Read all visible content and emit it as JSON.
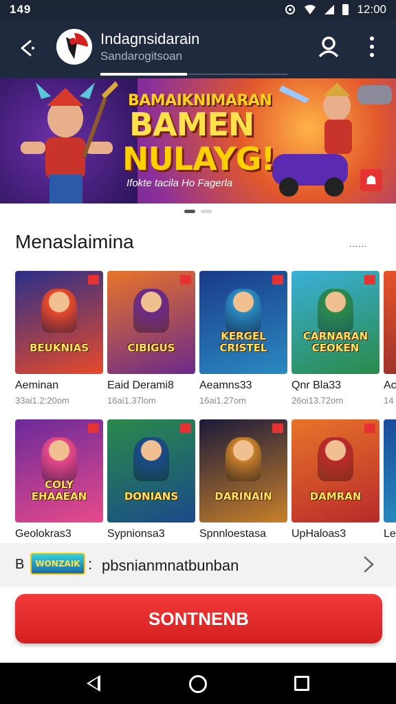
{
  "status_bar": {
    "left": "149",
    "time": "12:00"
  },
  "app_bar": {
    "title": "Indagnsidarain",
    "subtitle": "Sandarogitsoan",
    "icons": {
      "back": "back-arrow-icon",
      "account": "account-icon",
      "menu": "more-vert-icon"
    }
  },
  "banner": {
    "line1": "BAMAIKNIMARAN",
    "line2": "BAMEN",
    "line3": "NULAYG!",
    "tagline": "Ifokte tacila  Ho Fagerla",
    "slides": 2,
    "active_slide": 1
  },
  "section": {
    "title": "Menaslaimina",
    "more": "......"
  },
  "games_row1": [
    {
      "thumb_label": "BEUKNIAS",
      "title": "Aeminan",
      "sub": "33ai1.2:20om",
      "colors": [
        "#2a2f8a",
        "#e84a2a"
      ]
    },
    {
      "thumb_label": "CIBIGUS",
      "title": "Eaid Derami8",
      "sub": "16ai1.37lom",
      "colors": [
        "#e8742a",
        "#6a2a8a"
      ]
    },
    {
      "thumb_label": "KERGEL CRISTEL",
      "title": "Aeamns33",
      "sub": "16ai1.27om",
      "colors": [
        "#1a3a8a",
        "#2a8ac0"
      ]
    },
    {
      "thumb_label": "CARNARAN CEOKEN",
      "title": "Qnr Bla33",
      "sub": "26oi13.72om",
      "colors": [
        "#3ab0d8",
        "#2a8a4a"
      ]
    },
    {
      "thumb_label": "",
      "title": "Ac",
      "sub": "14",
      "colors": [
        "#e8542a",
        "#8a2a2a"
      ]
    }
  ],
  "games_row2": [
    {
      "thumb_label": "COLY EHAAEAN",
      "title": "Geolokras3",
      "colors": [
        "#6a2a9a",
        "#e84a8a"
      ]
    },
    {
      "thumb_label": "DONIANS",
      "title": "Sypnionsa3",
      "colors": [
        "#2a8a4a",
        "#1a4a8a"
      ]
    },
    {
      "thumb_label": "DARINAIN",
      "title": "Spnnloestasa",
      "colors": [
        "#1a1a3a",
        "#c8802a"
      ]
    },
    {
      "thumb_label": "DAMRAN",
      "title": "UpHaloas3",
      "colors": [
        "#e8742a",
        "#b82a2a"
      ]
    },
    {
      "thumb_label": "",
      "title": "Le",
      "colors": [
        "#1a4a9a",
        "#2a9ac8"
      ]
    }
  ],
  "promo": {
    "prefix": "B",
    "logo_text": "WONZAIK",
    "text": "pbsnianmnatbunban"
  },
  "cta": {
    "label": "SONTNENB"
  }
}
